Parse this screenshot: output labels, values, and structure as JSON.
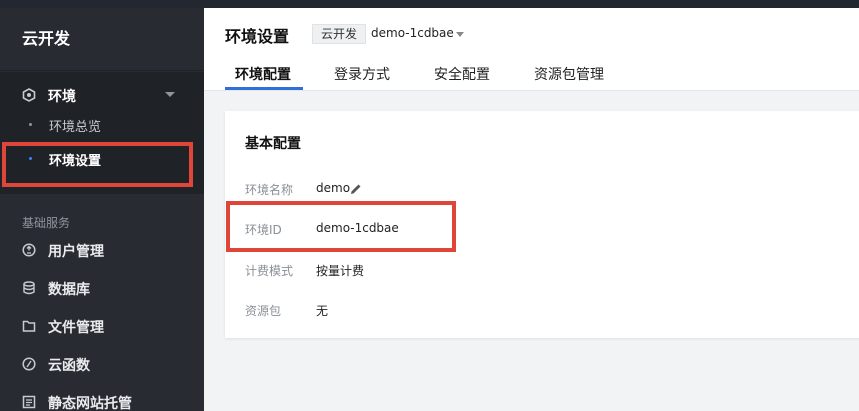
{
  "sidebar": {
    "brand": "云开发",
    "env_group": {
      "label": "环境"
    },
    "sub_items": [
      {
        "label": "环境总览",
        "active": false
      },
      {
        "label": "环境设置",
        "active": true
      }
    ],
    "section_label": "基础服务",
    "items": [
      {
        "label": "用户管理",
        "icon": "user-manage-icon"
      },
      {
        "label": "数据库",
        "icon": "database-icon"
      },
      {
        "label": "文件管理",
        "icon": "folder-icon"
      },
      {
        "label": "云函数",
        "icon": "function-icon"
      },
      {
        "label": "静态网站托管",
        "icon": "static-site-icon"
      }
    ]
  },
  "header": {
    "title": "环境设置",
    "env_tag": "云开发",
    "env_selected": "demo-1cdbae",
    "tabs": [
      {
        "label": "环境配置",
        "active": true
      },
      {
        "label": "登录方式",
        "active": false
      },
      {
        "label": "安全配置",
        "active": false
      },
      {
        "label": "资源包管理",
        "active": false
      }
    ]
  },
  "card": {
    "title": "基本配置",
    "rows": [
      {
        "label": "环境名称",
        "value": "demo"
      },
      {
        "label": "环境ID",
        "value": "demo-1cdbae"
      },
      {
        "label": "计费模式",
        "value": "按量计费"
      },
      {
        "label": "资源包",
        "value": "无"
      }
    ]
  },
  "colors": {
    "sidebar_bg": "#282b31",
    "accent": "#2f6fdb",
    "highlight": "#e0453a"
  }
}
